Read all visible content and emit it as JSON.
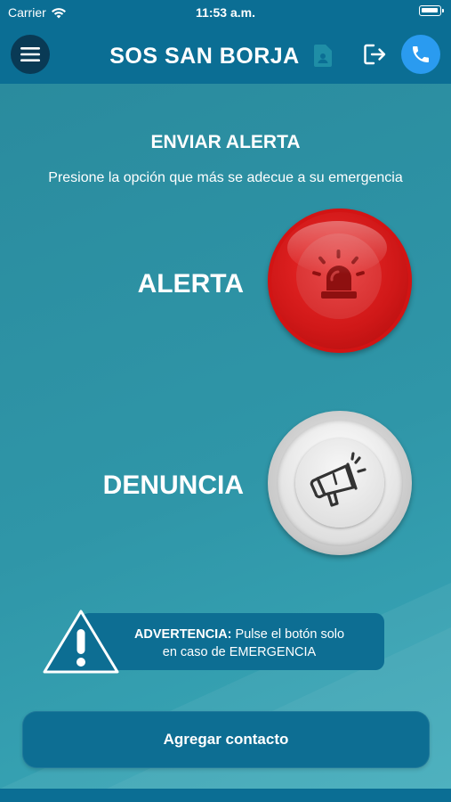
{
  "status_bar": {
    "carrier": "Carrier",
    "time": "11:53 a.m."
  },
  "header": {
    "title": "SOS SAN BORJA",
    "icons": [
      "menu-icon",
      "contact-card-icon",
      "logout-icon",
      "phone-icon"
    ]
  },
  "main": {
    "section_title": "ENVIAR ALERTA",
    "instruction": "Presione la opción que más se adecue a su emergencia",
    "options": [
      {
        "label": "ALERTA",
        "icon": "siren-icon",
        "color": "#d01818"
      },
      {
        "label": "DENUNCIA",
        "icon": "megaphone-icon",
        "color": "#d9d9d9"
      }
    ],
    "warning": {
      "title": "ADVERTENCIA:",
      "line1": " Pulse el botón solo",
      "line2": "en caso de EMERGENCIA",
      "icon": "warning-icon"
    },
    "add_contact_label": "Agregar contacto"
  },
  "colors": {
    "header": "#0b6e94",
    "background": "#2f96a8",
    "phone_button": "#2a9bf0",
    "menu_button": "#093a55"
  }
}
